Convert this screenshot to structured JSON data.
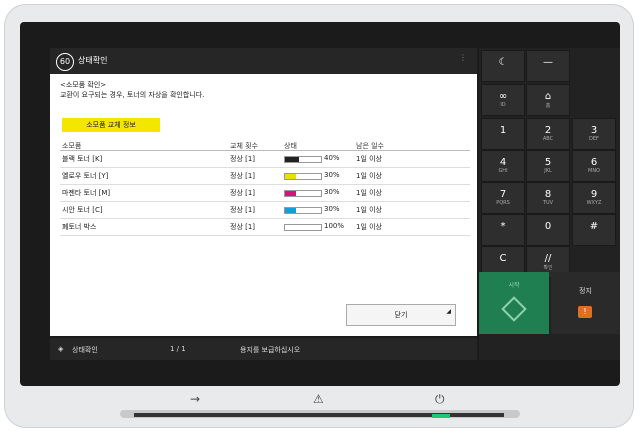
{
  "header": {
    "title": "상태확인",
    "logo": "60",
    "menu": "⋮"
  },
  "message": {
    "line1": "<소모품 확인>",
    "line2": "교환이 요구되는 경우, 토너의 자상을 확인합니다."
  },
  "yellow_button": {
    "label": "소모품 교체 정보"
  },
  "table": {
    "headers": [
      "소모품",
      "교체 횟수",
      "상태",
      "남은 일수"
    ],
    "rows": [
      {
        "name": "블랙 토너 [K]",
        "count": "정상 [1]",
        "pct": "40%",
        "days": "1일 이상",
        "color": "#222222",
        "level": 0.4
      },
      {
        "name": "옐로우 토너 [Y]",
        "count": "정상 [1]",
        "pct": "30%",
        "days": "1일 이상",
        "color": "#e8e100",
        "level": 0.3
      },
      {
        "name": "마젠타 토너 [M]",
        "count": "정상 [1]",
        "pct": "30%",
        "days": "1일 이상",
        "color": "#d4147c",
        "level": 0.3
      },
      {
        "name": "시안 토너 [C]",
        "count": "정상 [1]",
        "pct": "30%",
        "days": "1일 이상",
        "color": "#1a9ad6",
        "level": 0.3
      },
      {
        "name": "폐토너 박스",
        "count": "정상 [1]",
        "pct": "100%",
        "days": "1일 이상",
        "color": "#cccccc",
        "level": 0.0
      }
    ]
  },
  "footer_button": {
    "label": "닫기"
  },
  "statusbar": {
    "label": "상태확인",
    "page": "1 / 1",
    "msg": "용지를 보급하십시오"
  },
  "keypad": {
    "top": [
      {
        "n": "☾",
        "s": ""
      },
      {
        "n": "—",
        "s": ""
      }
    ],
    "row2": [
      {
        "n": "∞",
        "s": "ID"
      },
      {
        "n": "⌂",
        "s": "홈"
      }
    ],
    "keys": [
      "1",
      "2",
      "3",
      "4",
      "5",
      "6",
      "7",
      "8",
      "9",
      "*",
      "0",
      "#",
      "C",
      "//"
    ],
    "subs": [
      "",
      "ABC",
      "DEF",
      "GHI",
      "JKL",
      "MNO",
      "PQRS",
      "TUV",
      "WXYZ",
      "",
      "",
      "",
      "",
      "확인"
    ]
  },
  "start": {
    "label": "시작"
  },
  "stop": {
    "label": "정지",
    "icon": "!"
  },
  "hardware": {
    "icons": [
      "→",
      "⚠",
      "⏻"
    ]
  }
}
